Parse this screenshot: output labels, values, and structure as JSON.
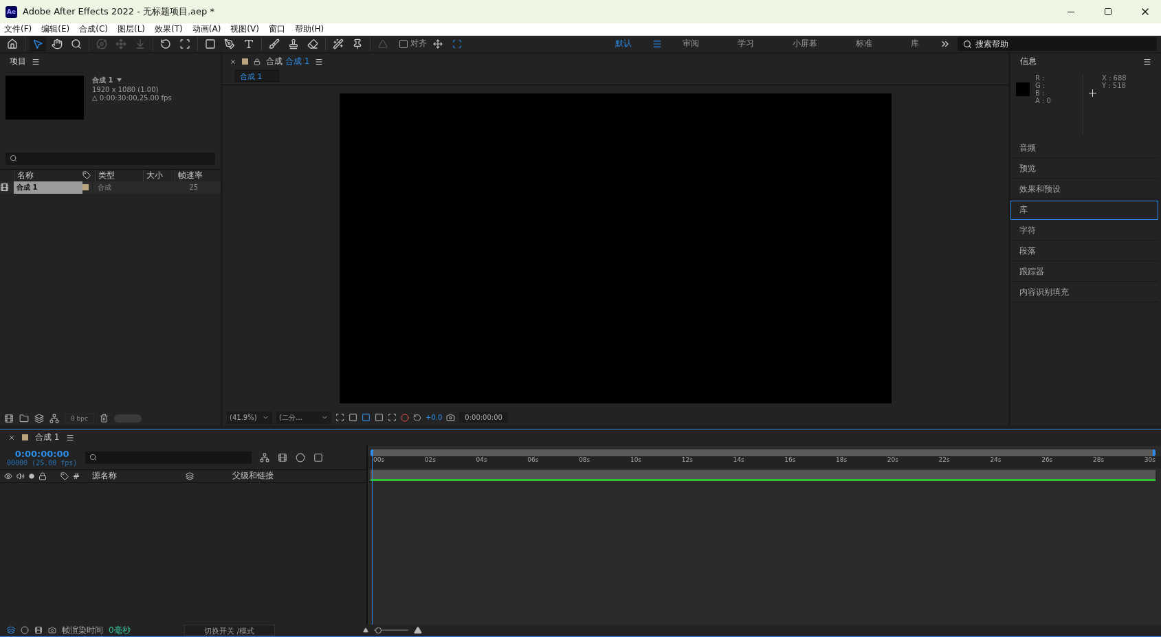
{
  "window": {
    "title": "Adobe After Effects 2022 - 无标题项目.aep *",
    "badge": "Ae"
  },
  "menu": [
    "文件(F)",
    "编辑(E)",
    "合成(C)",
    "图层(L)",
    "效果(T)",
    "动画(A)",
    "视图(V)",
    "窗口",
    "帮助(H)"
  ],
  "toolbar": {
    "tools": [
      {
        "selected": false,
        "disabled": false
      },
      {
        "selected": true,
        "disabled": false
      },
      {
        "selected": false,
        "disabled": false
      },
      {
        "selected": false,
        "disabled": false
      },
      {
        "selected": false,
        "disabled": true
      },
      {
        "selected": false,
        "disabled": true
      },
      {
        "selected": false,
        "disabled": true
      },
      {
        "selected": false,
        "disabled": false
      },
      {
        "selected": false,
        "disabled": false
      },
      {
        "selected": false,
        "disabled": false
      },
      {
        "selected": false,
        "disabled": false
      },
      {
        "selected": false,
        "disabled": false
      },
      {
        "selected": false,
        "disabled": false
      },
      {
        "selected": false,
        "disabled": false
      },
      {
        "selected": false,
        "disabled": false
      },
      {
        "selected": false,
        "disabled": false
      },
      {
        "selected": false,
        "disabled": false
      }
    ],
    "snap": {
      "label": "对齐",
      "checked": false
    }
  },
  "workspaces": [
    {
      "label": "默认",
      "selected": true
    },
    {
      "label": "审阅",
      "selected": false
    },
    {
      "label": "学习",
      "selected": false
    },
    {
      "label": "小屏幕",
      "selected": false
    },
    {
      "label": "标准",
      "selected": false
    },
    {
      "label": "库",
      "selected": false
    }
  ],
  "help_search": {
    "placeholder": "搜索帮助"
  },
  "project": {
    "title": "项目",
    "comp_name": "合成 1",
    "comp_size": "1920 x 1080 (1.00)",
    "comp_duration": "△ 0:00:30:00,25.00 fps",
    "columns": [
      "名称",
      "类型",
      "大小",
      "帧速率"
    ],
    "rows": [
      {
        "name": "合成 1",
        "type": "合成",
        "size": "",
        "fps": "25",
        "selected": true,
        "color": "#b9a47e"
      }
    ],
    "bpc": "8 bpc"
  },
  "viewer": {
    "tab_prefix": "合成",
    "tab_comp": "合成 1",
    "subtab": "合成 1",
    "zoom": "(41.9%)",
    "resolution": "(二分…",
    "exposure": "+0.0",
    "timecode": "0:00:00:00"
  },
  "info": {
    "title": "信息",
    "channels": [
      "R :",
      "G :",
      "B :",
      "A : 0"
    ],
    "x": "X : 688",
    "y": "Y : 518"
  },
  "panels": [
    {
      "label": "音频",
      "selected": false
    },
    {
      "label": "预览",
      "selected": false
    },
    {
      "label": "效果和预设",
      "selected": false
    },
    {
      "label": "库",
      "selected": true
    },
    {
      "label": "字符",
      "selected": false
    },
    {
      "label": "段落",
      "selected": false
    },
    {
      "label": "跟踪器",
      "selected": false
    },
    {
      "label": "内容识别填充",
      "selected": false
    }
  ],
  "timeline": {
    "tab": "合成 1",
    "time": "0:00:00:00",
    "frames": "00000 (25.00 fps)",
    "columns": {
      "number": "#",
      "source": "源名称",
      "parent": "父级和链接"
    },
    "ticks": [
      "00s",
      "02s",
      "04s",
      "06s",
      "08s",
      "10s",
      "12s",
      "14s",
      "16s",
      "18s",
      "20s",
      "22s",
      "24s",
      "26s",
      "28s",
      "30s"
    ]
  },
  "status": {
    "render_label": "帧渲染时间",
    "render_value": "0毫秒",
    "toggle": "切换开关 /模式",
    "zoom": {
      "level": 0.05
    }
  }
}
